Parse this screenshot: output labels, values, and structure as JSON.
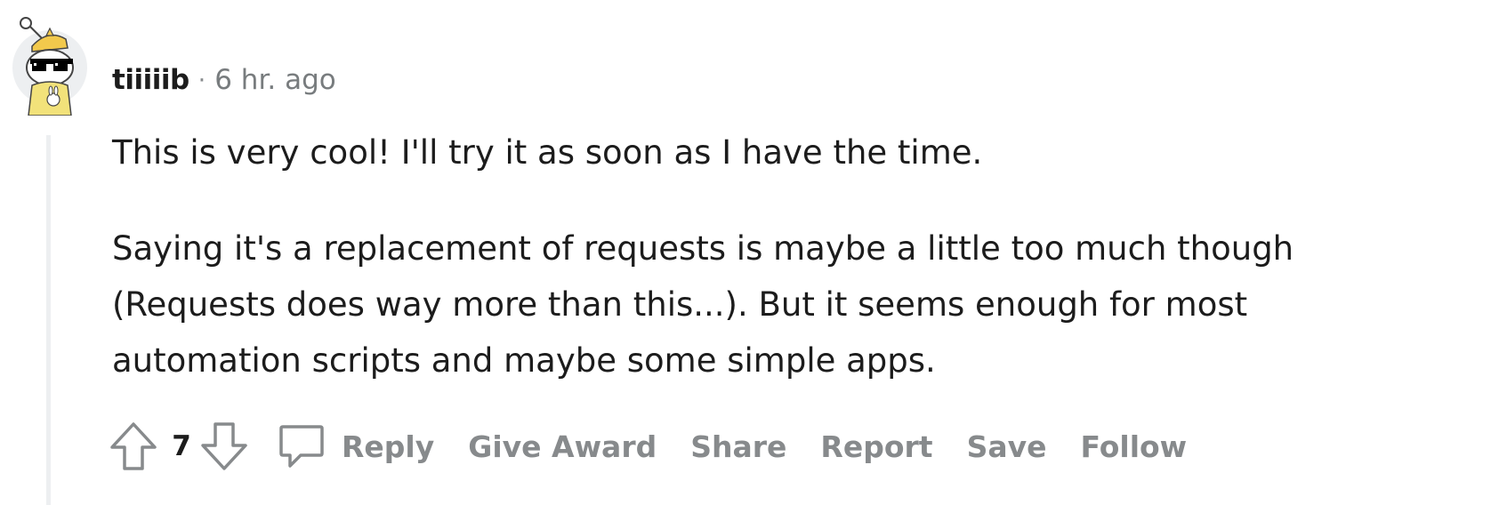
{
  "comment": {
    "author": "tiiiiib",
    "separator": "·",
    "timestamp": "6 hr. ago",
    "paragraphs": [
      "This is very cool! I'll try it as soon as I have the time.",
      "Saying it's a replacement of requests is maybe a little too much though (Requests does way more than this...). But it seems enough for most automation scripts and maybe some simple apps."
    ]
  },
  "actions": {
    "score": "7",
    "reply": "Reply",
    "give_award": "Give Award",
    "share": "Share",
    "report": "Report",
    "save": "Save",
    "follow": "Follow"
  },
  "colors": {
    "text_primary": "#1c1c1c",
    "text_muted": "#878a8c",
    "thread_line": "#edeff1",
    "avatar_bg": "#edeff1",
    "avatar_accent": "#f2c94c"
  },
  "icons": {
    "avatar": "snoo-avatar-with-sunglasses",
    "upvote": "arrow-up-outline-icon",
    "downvote": "arrow-down-outline-icon",
    "reply": "speech-bubble-icon"
  }
}
